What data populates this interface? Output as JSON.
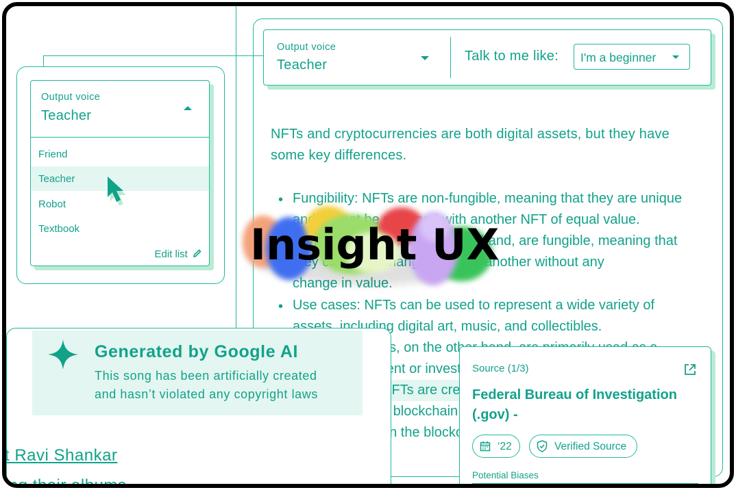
{
  "brand": {
    "logo_text": "Insight UX",
    "accent": "#12a28a",
    "accent_light": "#e4f6f1",
    "shadow": "#b9ecd3"
  },
  "main_card": {
    "output_voice_label": "Output voice",
    "output_voice_value": "Teacher",
    "talk_label": "Talk to me like:",
    "talk_value": "I'm a beginner",
    "intro": "NFTs and cryptocurrencies are both digital assets, but they have some key differences.",
    "bullets": [
      [
        "Fungibility: NFTs are non-fungible, meaning that they are unique",
        "and cannot be swapped with another NFT of equal value.",
        "Cryptocurrencies, on the other hand, are fungible, meaning that",
        "they can be exchanged for one another without any",
        "change in value."
      ],
      [
        "Use cases: NFTs can be used to represent a wide variety of",
        "assets, including digital art, music, and collectibles.",
        "Cryptocurrencies, on the other hand, are primarily used as a",
        "means of payment or investment."
      ],
      [
        "NFTs are created and stored on",
        "a blockchain, as well as digital",
        "on the blockchain."
      ]
    ]
  },
  "dropdown": {
    "label": "Output voice",
    "value": "Teacher",
    "options": [
      "Friend",
      "Teacher",
      "Robot",
      "Textbook"
    ],
    "selected_index": 1,
    "edit_label": "Edit list"
  },
  "generated": {
    "title": "Generated by Google AI",
    "line1": "This song has been artificially created",
    "line2": "and hasn’t violated any copyright laws",
    "link1": "t Ravi Shankar",
    "link2": "ing their albums"
  },
  "source": {
    "count": "Source (1/3)",
    "title": "Federal Bureau of Investigation (.gov) -",
    "year_chip": "‘22",
    "verified_chip": "Verified Source",
    "biases_label": "Potential Biases"
  }
}
